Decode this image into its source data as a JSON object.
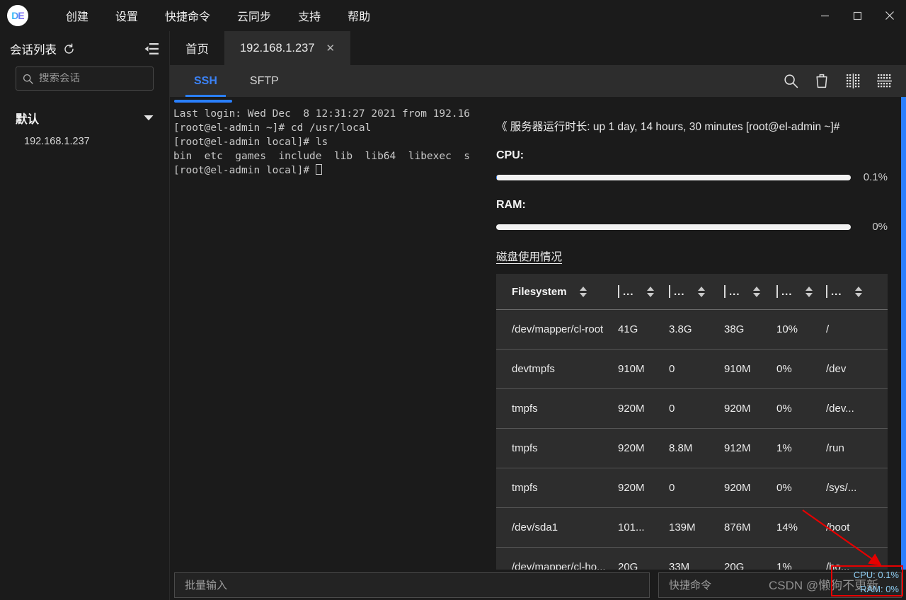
{
  "window": {
    "logo_glyph": "DE",
    "controls": {
      "minimize": "minimize-icon",
      "maximize": "maximize-icon",
      "close": "close-icon"
    }
  },
  "menu": {
    "items": [
      {
        "label": "创建"
      },
      {
        "label": "设置"
      },
      {
        "label": "快捷命令"
      },
      {
        "label": "云同步"
      },
      {
        "label": "支持"
      },
      {
        "label": "帮助"
      }
    ]
  },
  "sidebar": {
    "title": "会话列表",
    "refresh_icon": "refresh-icon",
    "collapse_icon": "collapse-panel-icon",
    "search": {
      "placeholder": "搜索会话",
      "value": "",
      "icon": "search-icon"
    },
    "group": {
      "label": "默认",
      "caret": "caret-down-icon",
      "expanded": true
    },
    "sessions": [
      {
        "label": "192.168.1.237"
      }
    ]
  },
  "tabs": [
    {
      "label": "首页",
      "active": false,
      "closable": false
    },
    {
      "label": "192.168.1.237",
      "active": true,
      "closable": true,
      "close_label": "✕"
    }
  ],
  "subtabs": [
    {
      "label": "SSH",
      "active": true
    },
    {
      "label": "SFTP",
      "active": false
    }
  ],
  "toolbar_icons": [
    {
      "name": "search-icon"
    },
    {
      "name": "trash-icon"
    },
    {
      "name": "split-vertical-icon"
    },
    {
      "name": "split-horizontal-icon"
    }
  ],
  "terminal": {
    "lines": [
      {
        "text": "Last login: Wed Dec  8 12:31:27 2021 from 192.16",
        "color": "default"
      },
      {
        "text": "[root@el-admin ~]# cd /usr/local",
        "color": "default"
      },
      {
        "text": "[root@el-admin local]# ls",
        "color": "default"
      },
      {
        "text": "bin  etc  games  include  lib  lib64  libexec  s",
        "color": "blue"
      },
      {
        "text": "[root@el-admin local]# ",
        "color": "default"
      }
    ],
    "blue_color": "#4b6ee8",
    "text_color": "#c9c9c9"
  },
  "panel": {
    "uptime": "《 服务器运行时长: up 1 day, 14 hours, 30 minutes [root@el-admin ~]#",
    "cpu": {
      "label": "CPU:",
      "value": "0.1%",
      "percent": 0.1
    },
    "ram": {
      "label": "RAM:",
      "value": "0%",
      "percent": 0
    },
    "disk_title": "磁盘使用情况",
    "table": {
      "headers": [
        {
          "label": "Filesystem",
          "truncated": false
        },
        {
          "label": "...",
          "truncated": true
        },
        {
          "label": "...",
          "truncated": true
        },
        {
          "label": "...",
          "truncated": true
        },
        {
          "label": "...",
          "truncated": true
        },
        {
          "label": "...",
          "truncated": true
        }
      ],
      "rows": [
        [
          "/dev/mapper/cl-root",
          "41G",
          "3.8G",
          "38G",
          "10%",
          "/"
        ],
        [
          "devtmpfs",
          "910M",
          "0",
          "910M",
          "0%",
          "/dev"
        ],
        [
          "tmpfs",
          "920M",
          "0",
          "920M",
          "0%",
          "/dev..."
        ],
        [
          "tmpfs",
          "920M",
          "8.8M",
          "912M",
          "1%",
          "/run"
        ],
        [
          "tmpfs",
          "920M",
          "0",
          "920M",
          "0%",
          "/sys/..."
        ],
        [
          "/dev/sda1",
          "101...",
          "139M",
          "876M",
          "14%",
          "/boot"
        ],
        [
          "/dev/mapper/cl-ho...",
          "20G",
          "33M",
          "20G",
          "1%",
          "/ho..."
        ]
      ]
    }
  },
  "bottom": {
    "batch_input": {
      "placeholder": "批量输入",
      "value": ""
    },
    "quick_command": {
      "placeholder": "快捷命令",
      "value": ""
    }
  },
  "annotations": {
    "watermark": "CSDN @懒狗不更新",
    "highlight_box_color": "#e60000",
    "floating_stats": {
      "cpu": "CPU: 0.1%",
      "ram": "RAM: 0%",
      "color": "#8ecdf2"
    }
  },
  "colors": {
    "accent_blue": "#2a7fff",
    "active_tab_text": "#3b82f6",
    "window_bg": "#1b1b1b",
    "tab_active_bg": "#2d2d2d",
    "table_bg": "#2d2d2d"
  }
}
